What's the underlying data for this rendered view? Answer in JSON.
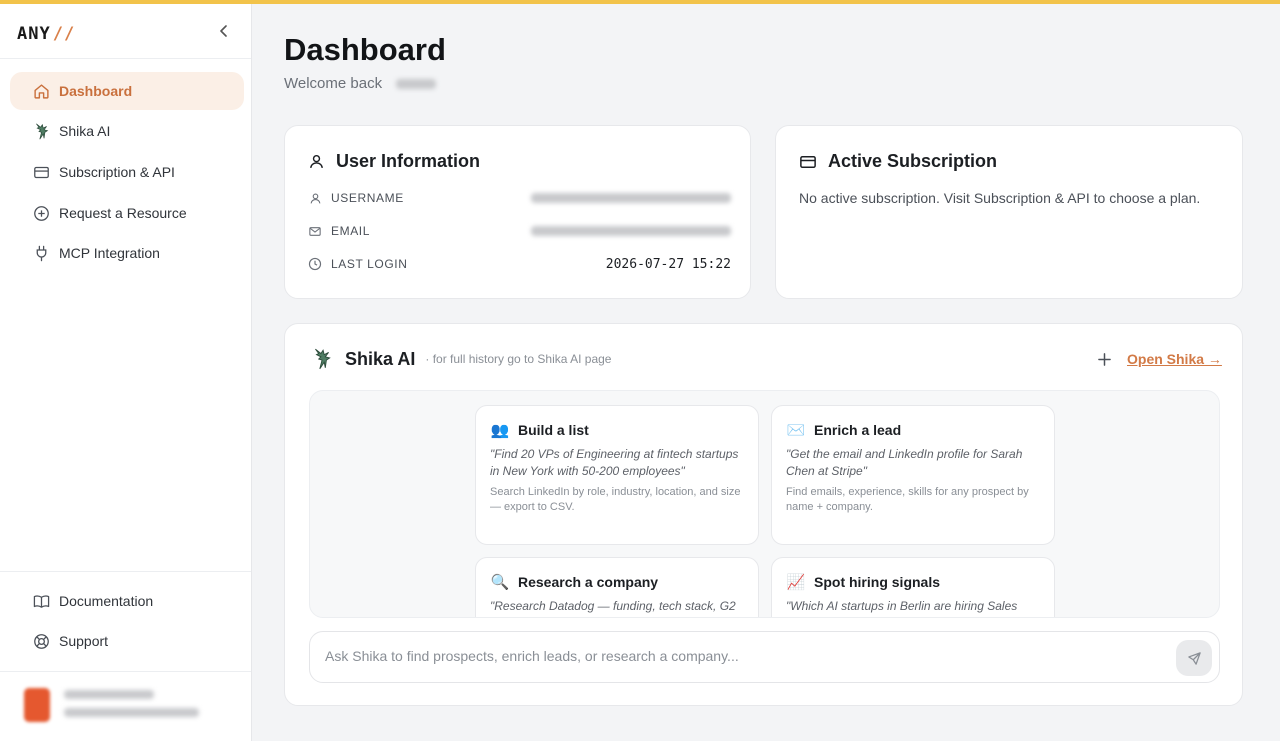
{
  "brand": {
    "name": "ANY",
    "accent": "//"
  },
  "colors": {
    "accent": "#d27a46",
    "active_bg": "#fbefe6",
    "top_bar": "#f2c34a"
  },
  "sidebar": {
    "items": [
      {
        "label": "Dashboard",
        "icon": "home-icon",
        "active": true
      },
      {
        "label": "Shika AI",
        "icon": "shika-logo-icon",
        "active": false
      },
      {
        "label": "Subscription & API",
        "icon": "credit-card-icon",
        "active": false
      },
      {
        "label": "Request a Resource",
        "icon": "plus-circle-icon",
        "active": false
      },
      {
        "label": "MCP Integration",
        "icon": "plug-icon",
        "active": false
      }
    ],
    "footer_items": [
      {
        "label": "Documentation",
        "icon": "book-icon"
      },
      {
        "label": "Support",
        "icon": "lifebuoy-icon"
      }
    ]
  },
  "header": {
    "title": "Dashboard",
    "welcome": "Welcome back"
  },
  "user_info": {
    "title": "User Information",
    "rows": [
      {
        "label": "USERNAME",
        "value": "",
        "icon": "user-icon"
      },
      {
        "label": "EMAIL",
        "value": "",
        "icon": "mail-icon"
      },
      {
        "label": "LAST LOGIN",
        "value": "2026-07-27 15:22",
        "icon": "clock-icon"
      }
    ]
  },
  "subscription": {
    "title": "Active Subscription",
    "message": "No active subscription. Visit Subscription & API to choose a plan."
  },
  "shika": {
    "title": "Shika AI",
    "hint": "· for full history go to Shika AI page",
    "open_label": "Open Shika →",
    "suggestions": [
      {
        "emoji": "👥",
        "title": "Build a list",
        "quote": "\"Find 20 VPs of Engineering at fintech startups in New York with 50-200 employees\"",
        "desc": "Search LinkedIn by role, industry, location, and size — export to CSV."
      },
      {
        "emoji": "✉️",
        "title": "Enrich a lead",
        "quote": "\"Get the email and LinkedIn profile for Sarah Chen at Stripe\"",
        "desc": "Find emails, experience, skills for any prospect by name + company."
      },
      {
        "emoji": "🔍",
        "title": "Research a company",
        "quote": "\"Research Datadog — funding, tech stack, G2",
        "desc": ""
      },
      {
        "emoji": "📈",
        "title": "Spot hiring signals",
        "quote": "\"Which AI startups in Berlin are hiring Sales",
        "desc": ""
      }
    ],
    "input_placeholder": "Ask Shika to find prospects, enrich leads, or research a company..."
  }
}
